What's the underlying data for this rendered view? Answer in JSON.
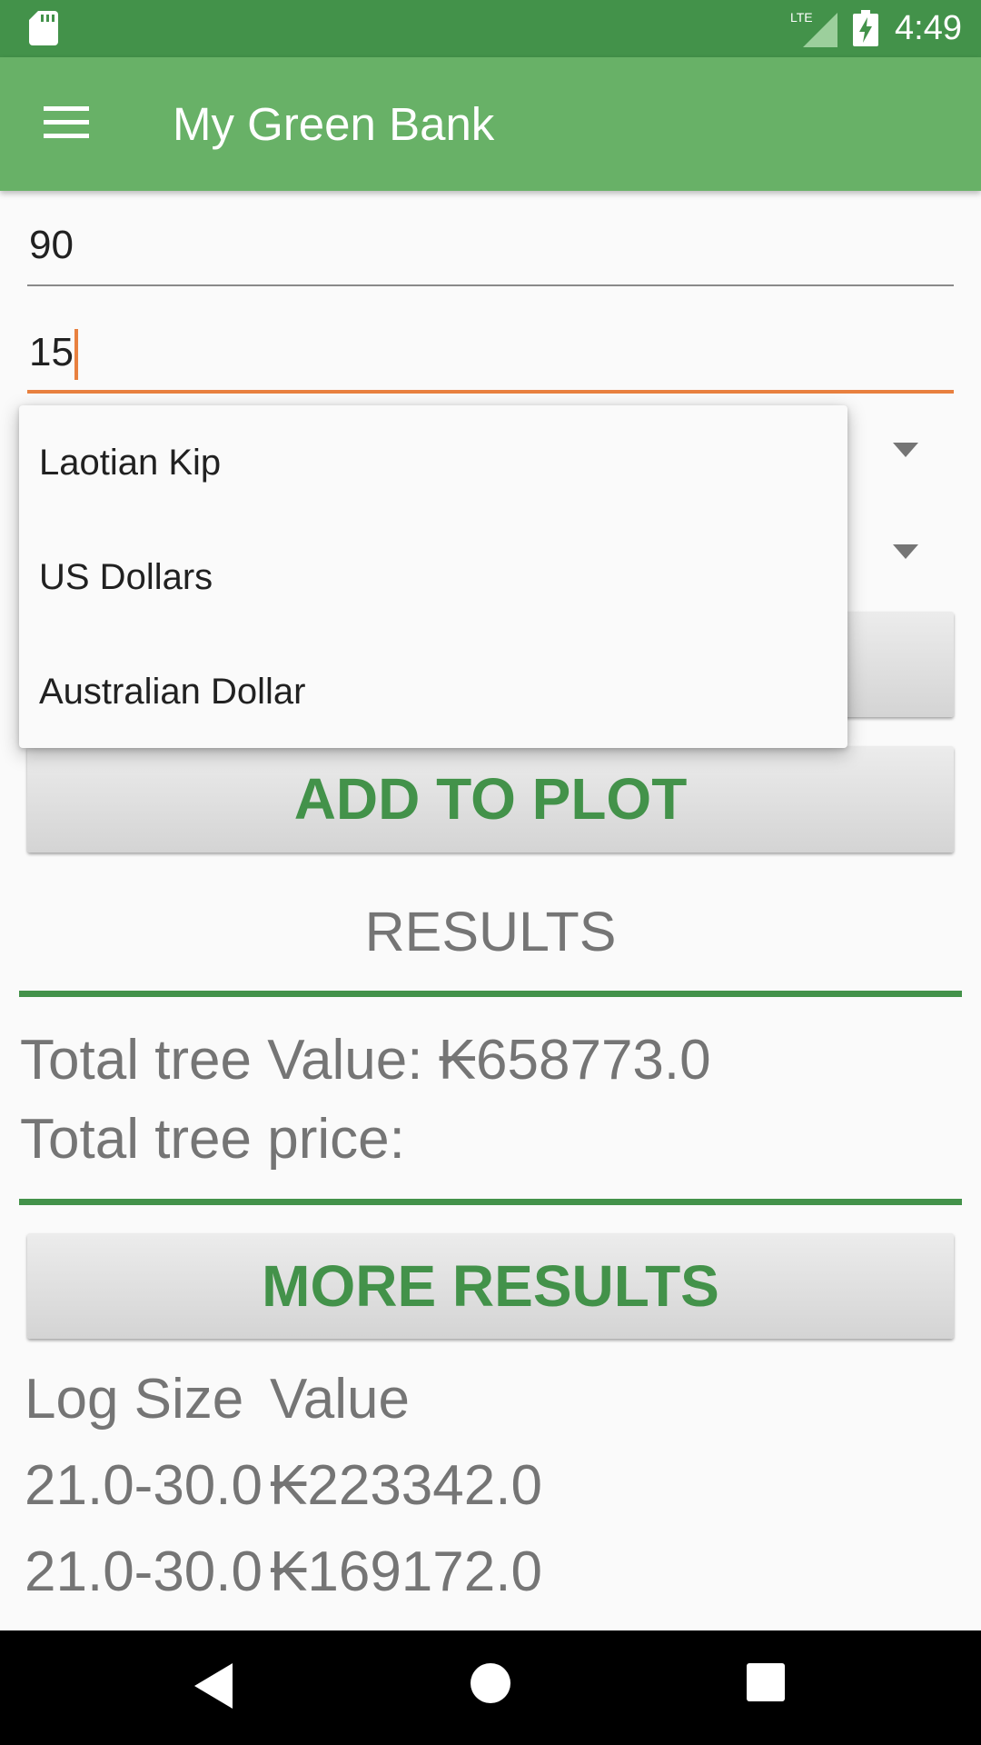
{
  "status_bar": {
    "time": "4:49",
    "network": "LTE",
    "icons": [
      "sd-card-icon",
      "lte-signal-icon",
      "battery-charging-icon"
    ]
  },
  "app_bar": {
    "title": "My Green Bank",
    "menu_icon": "hamburger-menu-icon"
  },
  "inputs": {
    "field_1_value": "90",
    "field_2_value": "15"
  },
  "dropdown": {
    "options": [
      "Laotian Kip",
      "US Dollars",
      "Australian Dollar"
    ]
  },
  "buttons": {
    "add_to_plot": "ADD TO PLOT",
    "more_results": "MORE RESULTS"
  },
  "results": {
    "heading": "RESULTS",
    "total_value": "Total tree Value: ₭658773.0",
    "total_price": "Total tree price:"
  },
  "log_table": {
    "headers": [
      "Log Size",
      "Value"
    ],
    "rows": [
      [
        "21.0-30.0",
        "₭223342.0"
      ],
      [
        "21.0-30.0",
        "₭169172.0"
      ]
    ]
  },
  "colors": {
    "status_bar": "#43924a",
    "app_bar": "#68b167",
    "accent": "#e8803f",
    "button_text": "#43924a"
  },
  "nav_bar": {
    "icons": [
      "back-icon",
      "home-icon",
      "recents-icon"
    ]
  }
}
